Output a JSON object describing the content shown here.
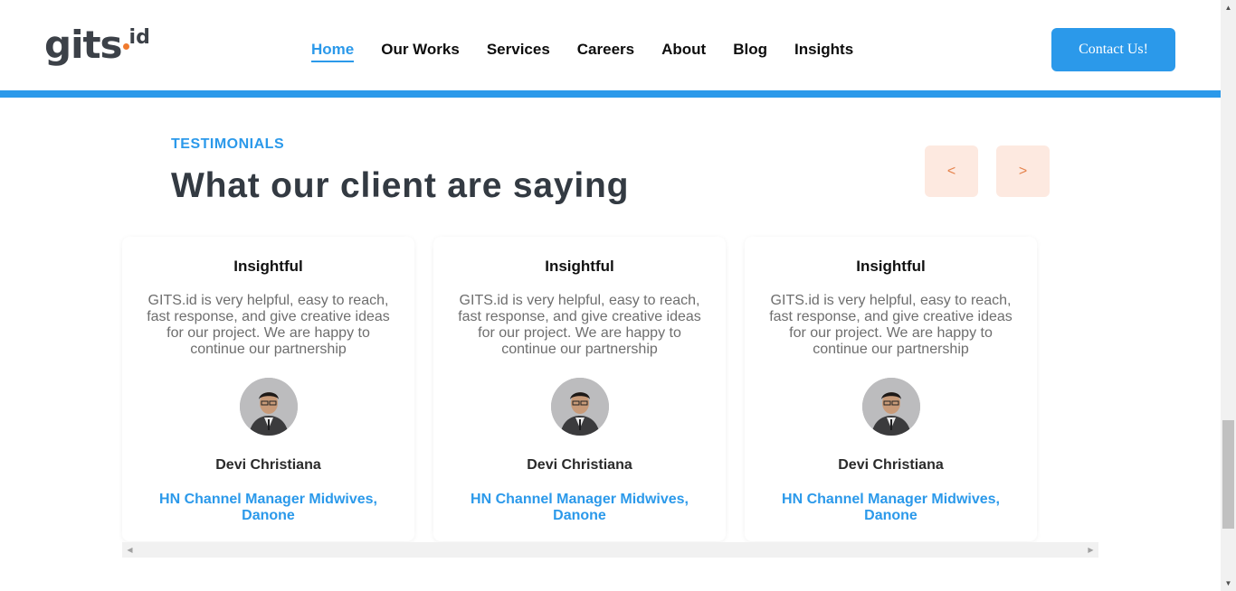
{
  "brand": {
    "logo_main": "gits",
    "logo_sub": "id",
    "accent": "#2b99ea",
    "dot_color": "#f07b2e"
  },
  "nav": {
    "items": [
      {
        "label": "Home",
        "active": true
      },
      {
        "label": "Our Works"
      },
      {
        "label": "Services"
      },
      {
        "label": "Careers"
      },
      {
        "label": "About"
      },
      {
        "label": "Blog"
      },
      {
        "label": "Insights"
      }
    ],
    "contact_label": "Contact Us!"
  },
  "section": {
    "eyebrow": "TESTIMONIALS",
    "title": "What our client are saying",
    "prev_label": "<",
    "next_label": ">"
  },
  "testimonials": [
    {
      "heading": "Insightful",
      "body": "GITS.id is very helpful, easy to reach, fast response, and give creative ideas for our project. We are happy to continue our partnership",
      "name": "Devi Christiana",
      "role": "HN Channel Manager Midwives, Danone"
    },
    {
      "heading": "Insightful",
      "body": "GITS.id is very helpful, easy to reach, fast response, and give creative ideas for our project. We are happy to continue our partnership",
      "name": "Devi Christiana",
      "role": "HN Channel Manager Midwives, Danone"
    },
    {
      "heading": "Insightful",
      "body": "GITS.id is very helpful, easy to reach, fast response, and give creative ideas for our project. We are happy to continue our partnership",
      "name": "Devi Christiana",
      "role": "HN Channel Manager Midwives, Danone"
    }
  ]
}
